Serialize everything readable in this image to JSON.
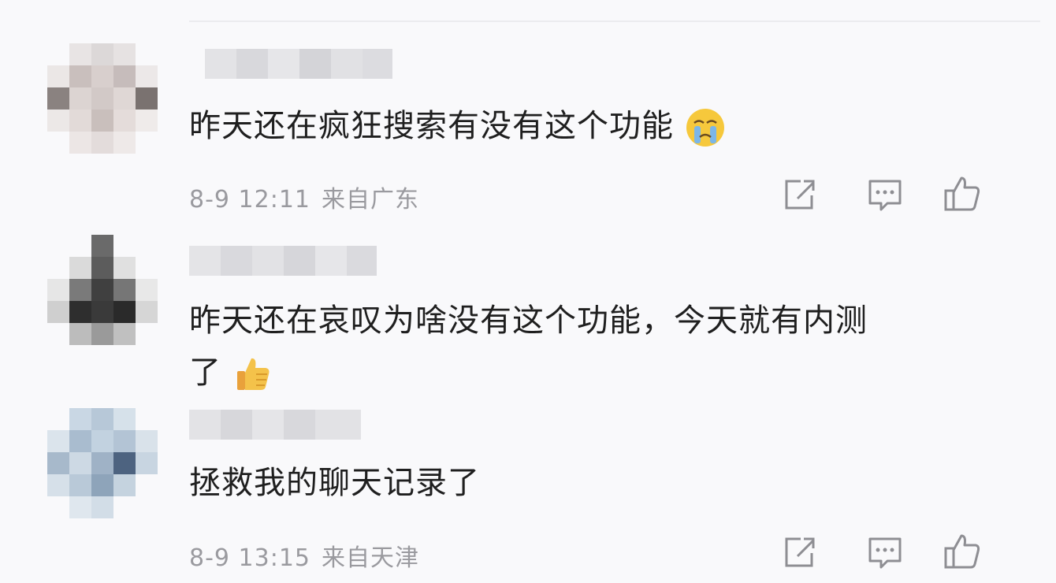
{
  "comments": [
    {
      "text": "昨天还在疯狂搜索有没有这个功能",
      "emoji": "crying-face-emoji",
      "date": "8-9 12:11",
      "location": "来自广东"
    },
    {
      "text_line1": "昨天还在哀叹为啥没有这个功能，今天就有内测",
      "text_line2": "了",
      "emoji": "thumbs-up-emoji"
    },
    {
      "text": "拯救我的聊天记录了",
      "date": "8-9 13:15",
      "location": "来自天津"
    }
  ],
  "icons": {
    "share": "share-icon",
    "comment": "comment-icon",
    "like": "like-icon"
  },
  "colors": {
    "background": "#f9f9fb",
    "text": "#1f1f1f",
    "meta": "#9a9a9f",
    "icon": "#8e8e93"
  }
}
